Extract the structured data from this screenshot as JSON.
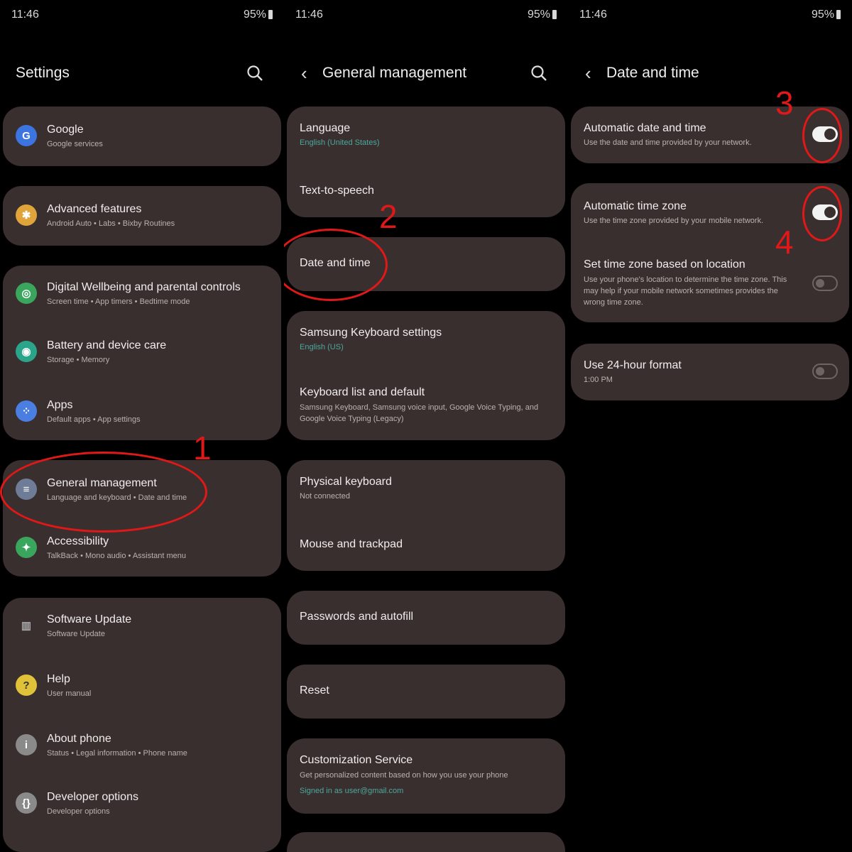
{
  "status": {
    "time": "11:46",
    "battery": "95%"
  },
  "panel1": {
    "title": "Settings",
    "items": [
      {
        "title": "Google",
        "sub": "Google services"
      },
      {
        "title": "Advanced features",
        "sub": "Android Auto  •  Labs  •  Bixby Routines"
      },
      {
        "title": "Digital Wellbeing and parental controls",
        "sub": "Screen time  •  App timers  •  Bedtime mode"
      },
      {
        "title": "Battery and device care",
        "sub": "Storage  •  Memory"
      },
      {
        "title": "Apps",
        "sub": "Default apps  •  App settings"
      },
      {
        "title": "General management",
        "sub": "Language and keyboard  •  Date and time"
      },
      {
        "title": "Accessibility",
        "sub": "TalkBack  •  Mono audio  •  Assistant menu"
      },
      {
        "title": "Software Update",
        "sub": "Software Update"
      },
      {
        "title": "Help",
        "sub": "User manual"
      },
      {
        "title": "About phone",
        "sub": "Status  •  Legal information  •  Phone name"
      },
      {
        "title": "Developer options",
        "sub": "Developer options"
      }
    ]
  },
  "panel2": {
    "title": "General management",
    "items": [
      {
        "title": "Language",
        "sub": "English (United States)"
      },
      {
        "title": "Text-to-speech"
      },
      {
        "title": "Date and time"
      },
      {
        "title": "Samsung Keyboard settings",
        "sub": "English (US)"
      },
      {
        "title": "Keyboard list and default",
        "sub": "Samsung Keyboard, Samsung voice input, Google Voice Typing, and Google Voice Typing (Legacy)"
      },
      {
        "title": "Physical keyboard",
        "sub": "Not connected"
      },
      {
        "title": "Mouse and trackpad"
      },
      {
        "title": "Passwords and autofill"
      },
      {
        "title": "Reset"
      },
      {
        "title": "Customization Service",
        "sub": "Get personalized content based on how you use your phone",
        "sub2": "Signed in as user@gmail.com"
      }
    ]
  },
  "panel3": {
    "title": "Date and time",
    "items": [
      {
        "title": "Automatic date and time",
        "sub": "Use the date and time provided by your network.",
        "toggle": "on"
      },
      {
        "title": "Automatic time zone",
        "sub": "Use the time zone provided by your mobile network.",
        "toggle": "on"
      },
      {
        "title": "Set time zone based on location",
        "sub": "Use your phone's location to determine the time zone. This may help if your mobile network sometimes provides the wrong time zone.",
        "toggle": "off"
      },
      {
        "title": "Use 24-hour format",
        "sub": "1:00 PM",
        "toggle": "off"
      }
    ]
  },
  "annotations": {
    "n1": "1",
    "n2": "2",
    "n3": "3",
    "n4": "4"
  },
  "colors": {
    "card": "#3a2f2f",
    "annotation": "#e01818",
    "teal": "#4aa89c"
  },
  "icons": [
    "google-icon",
    "advanced-features-icon",
    "wellbeing-icon",
    "battery-care-icon",
    "apps-icon",
    "general-management-icon",
    "accessibility-icon",
    "software-update-icon",
    "help-icon",
    "about-phone-icon",
    "developer-options-icon"
  ]
}
